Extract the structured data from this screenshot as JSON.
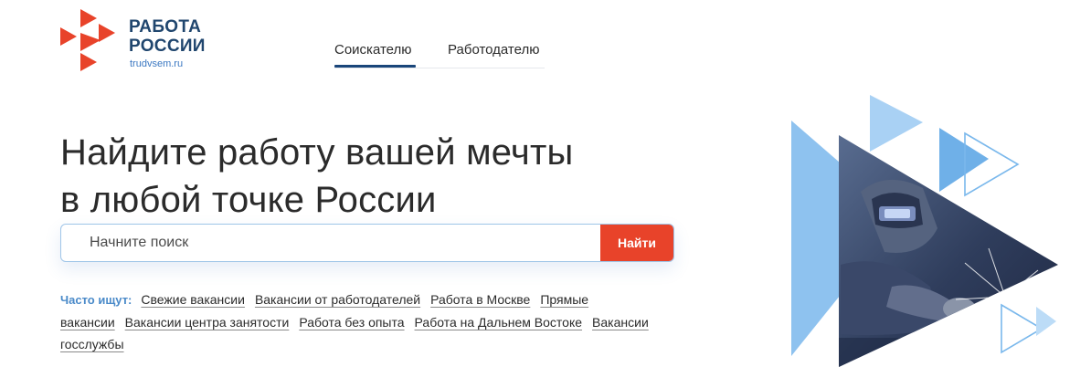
{
  "logo": {
    "title_line1": "РАБОТА",
    "title_line2": "РОССИИ",
    "subtitle": "trudvsem.ru",
    "icon": "logo-triangles-icon",
    "colors": {
      "red": "#e8432a",
      "blue": "#20466e"
    }
  },
  "nav": {
    "tabs": [
      {
        "label": "Соискателю",
        "active": true
      },
      {
        "label": "Работодателю",
        "active": false
      }
    ]
  },
  "hero": {
    "line1": "Найдите работу вашей мечты",
    "line2": "в любой точке России"
  },
  "search": {
    "placeholder": "Начните поиск",
    "value": "",
    "button_label": "Найти"
  },
  "popular": {
    "label": "Часто ищут:",
    "links": [
      "Свежие вакансии",
      "Вакансии от работодателей",
      "Работа в Москве",
      "Прямые вакансии",
      "Вакансии центра занятости",
      "Работа без опыта",
      "Работа на Дальнем Востоке",
      "Вакансии госслужбы"
    ]
  },
  "colors": {
    "accent": "#e8432a",
    "nav_active": "#1a467a",
    "link_label": "#4a8ac9",
    "triangle_blue": "#6fb0e8"
  }
}
